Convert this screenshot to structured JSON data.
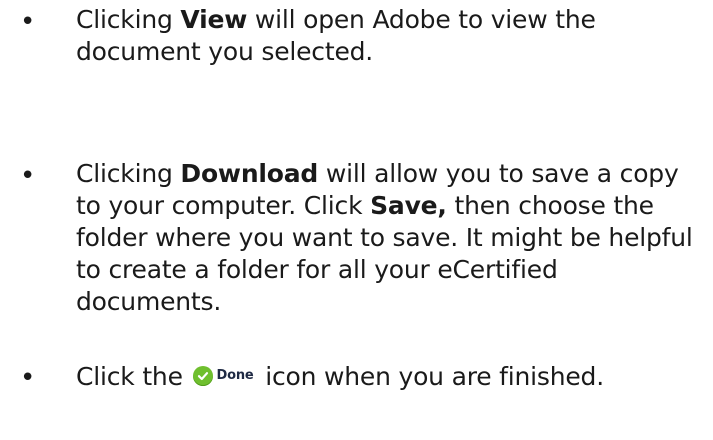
{
  "bullet_symbol": "•",
  "items": [
    {
      "pre": "Clicking ",
      "bold": "View",
      "post": " will open Adobe to view the document you selected."
    },
    {
      "pre": "Clicking ",
      "bold": "Download",
      "mid": " will allow you to save a copy to your computer. Click ",
      "bold2": "Save,",
      "post": " then choose the folder where you want to save.  It might be helpful to create a folder for all your eCertified documents."
    },
    {
      "pre": "Click the ",
      "icon": "done-check-icon",
      "icon_label": "Done",
      "post": " icon when you are finished."
    }
  ],
  "colors": {
    "text": "#1a1a1a",
    "done_green": "#6fbf2e"
  }
}
